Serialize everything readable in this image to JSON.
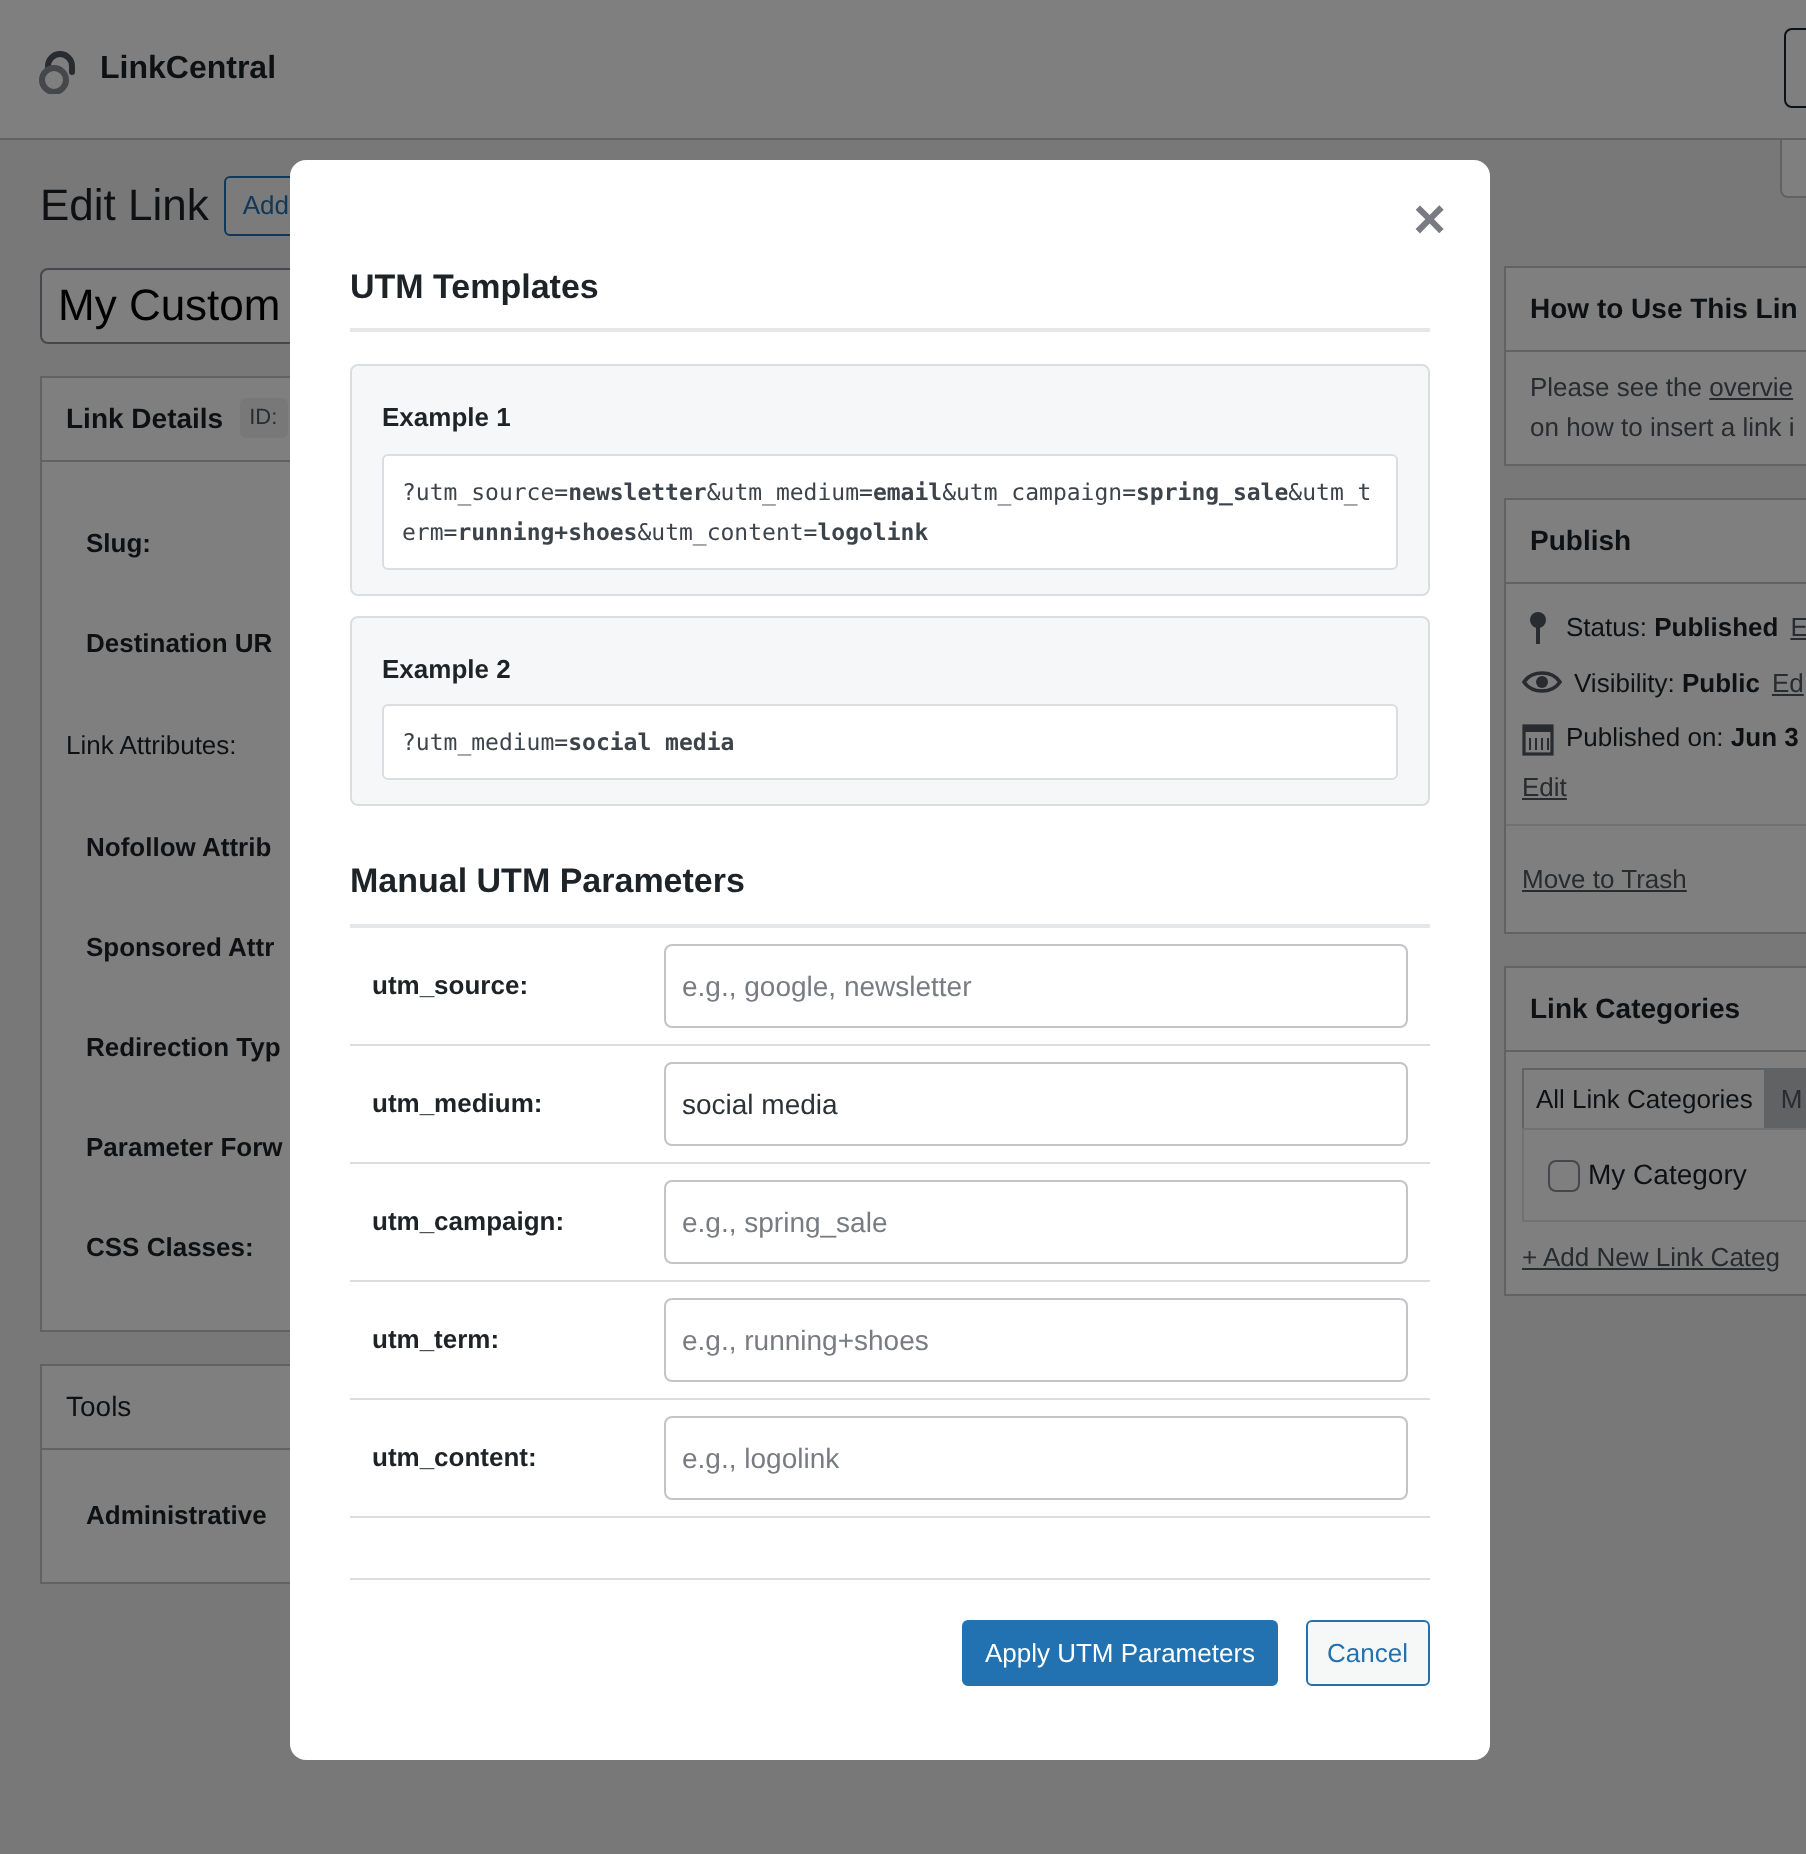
{
  "header": {
    "logo_text": "LinkCentral"
  },
  "page": {
    "title": "Edit Link",
    "add_button": "Add",
    "title_field": "My Custom"
  },
  "link_details": {
    "title": "Link Details",
    "badge": "ID:",
    "fields": [
      {
        "kind": "field",
        "label": "Slug:"
      },
      {
        "kind": "field",
        "label": "Destination UR"
      },
      {
        "kind": "section",
        "label": "Link Attributes:"
      },
      {
        "kind": "field",
        "label": "Nofollow Attrib"
      },
      {
        "kind": "field",
        "label": "Sponsored Attr"
      },
      {
        "kind": "field",
        "label": "Redirection Typ"
      },
      {
        "kind": "field",
        "label": "Parameter Forw"
      },
      {
        "kind": "field",
        "label": "CSS Classes:"
      }
    ]
  },
  "tools": {
    "title": "Tools",
    "items": [
      "Administrative"
    ]
  },
  "how_to": {
    "title": "How to Use This Lin",
    "text_before": "Please see the",
    "link": "overvie",
    "text_after": "on how to insert a link i"
  },
  "publish": {
    "title": "Publish",
    "rows": [
      {
        "text": "Status: **Published**",
        "link": "E"
      },
      {
        "text": "Visibility: **Public**",
        "link": "Ed"
      },
      {
        "text": "Published on: **Jun 3**",
        "link": "Edit"
      }
    ],
    "trash_link": "Move to Trash"
  },
  "categories": {
    "title": "Link Categories",
    "tabs": [
      {
        "label": "All Link Categories",
        "selected": true
      },
      {
        "label": "M",
        "selected": false
      }
    ],
    "items": [
      {
        "label": "My Category",
        "checked": false
      }
    ],
    "add_link": "+ Add New Link Categ"
  },
  "modal": {
    "close": "×",
    "templates_title": "UTM Templates",
    "examples": [
      {
        "title": "Example 1",
        "code": "?utm_source=**newsletter**&utm_medium=**email**&utm_campaign=**spring_sale**&utm_term=**running+shoes**&utm_content=**logolink**"
      },
      {
        "title": "Example 2",
        "code": "?utm_medium=**social media**"
      }
    ],
    "manual_title": "Manual UTM Parameters",
    "params": [
      {
        "label": "utm_source:",
        "placeholder": "e.g., google, newsletter"
      },
      {
        "label": "utm_medium:",
        "value": "social media"
      },
      {
        "label": "utm_campaign:",
        "placeholder": "e.g., spring_sale"
      },
      {
        "label": "utm_term:",
        "placeholder": "e.g., running+shoes"
      },
      {
        "label": "utm_content:",
        "placeholder": "e.g., logolink"
      }
    ],
    "buttons": [
      {
        "kind": "primary",
        "label": "Apply UTM Parameters"
      },
      {
        "kind": "secondary",
        "label": "Cancel"
      }
    ]
  }
}
